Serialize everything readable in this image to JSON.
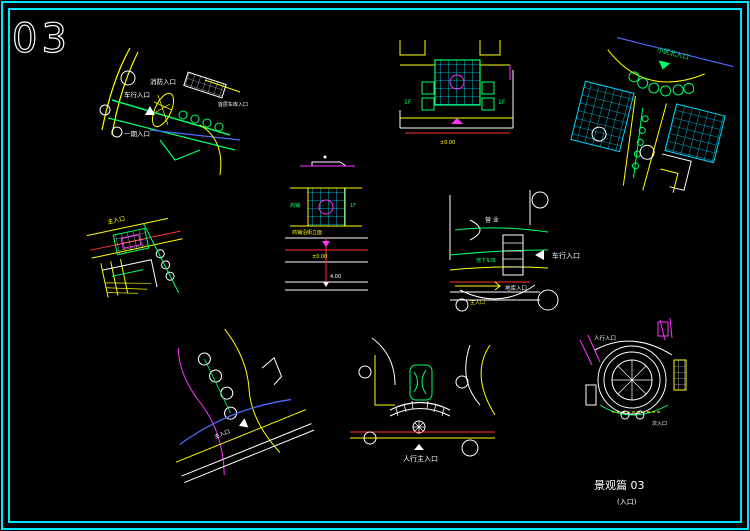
{
  "sheet": {
    "number": "03",
    "title": "景观篇 03",
    "subtitle": "(入口)"
  },
  "colors": {
    "frame": "#00e5ff",
    "line": "#ffffff",
    "road": "#ffff00",
    "green": "#00ff66",
    "red": "#ff3030",
    "magenta": "#ff33ff",
    "blue": "#4f6bff",
    "cyan": "#00d8ff"
  },
  "plans": {
    "p1": {
      "car": "车行入口",
      "fire": "消防入口",
      "ped": "一期入口",
      "note": "首层车库入口"
    },
    "p2": {
      "left": "1F",
      "right": "1F",
      "level": "±0.00"
    },
    "p3": {
      "entry": "小区北入口"
    },
    "p4": {
      "entry": "主入口"
    },
    "p5": {
      "left": "商铺",
      "right": "1F",
      "note": "商铺沿街立面",
      "level": "±0.00",
      "axis": "4.00"
    },
    "p6": {
      "shop": "营 业",
      "car": "车行入口",
      "garage": "地下车库",
      "walk": "地库入口",
      "main": "主入口"
    },
    "p7": {
      "entry": "主入口"
    },
    "p8": {
      "entry": "人行主入口"
    },
    "p9": {
      "entry": "人行入口",
      "sub": "次入口"
    }
  }
}
